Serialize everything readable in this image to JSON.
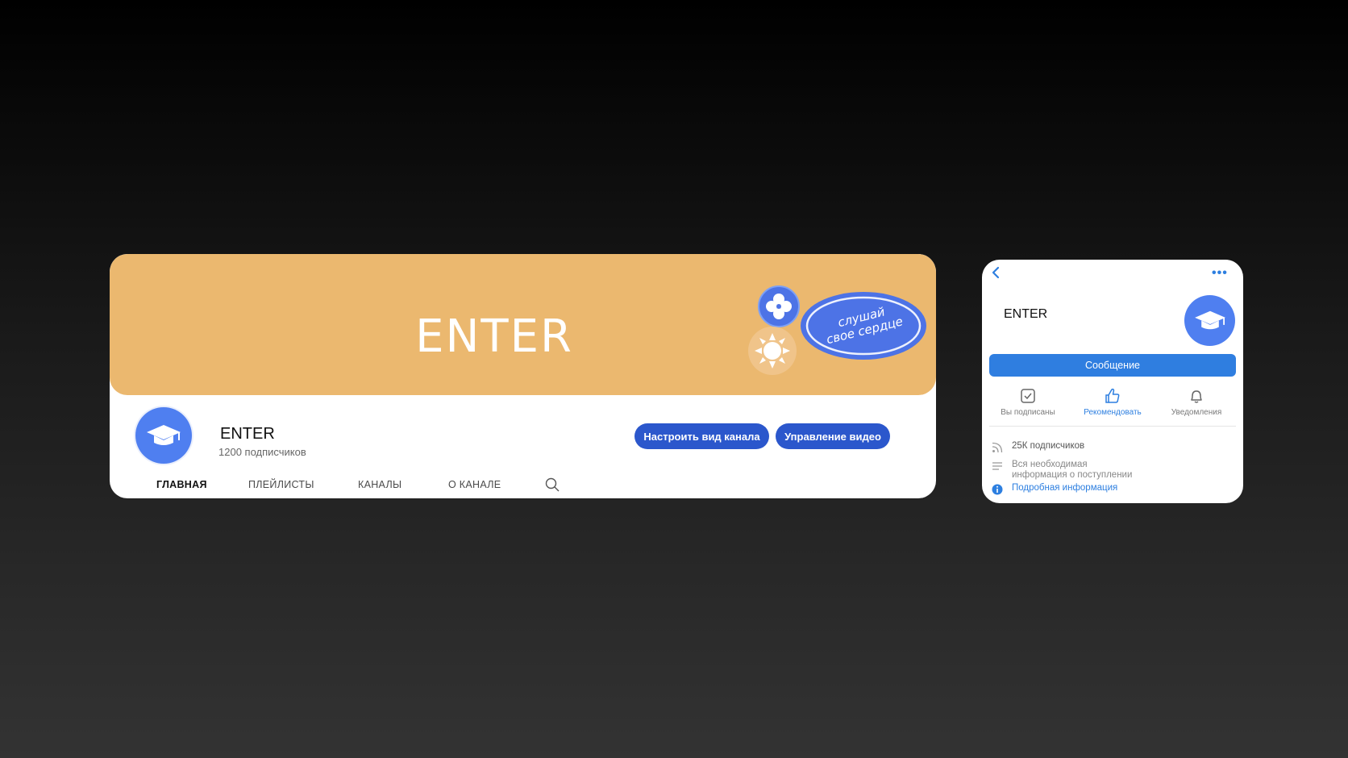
{
  "desktop": {
    "banner": {
      "title": "ENTER",
      "sticker_line1": "слушай",
      "sticker_line2": "свое сердце",
      "background_color": "#ebb86f"
    },
    "channel": {
      "name": "ENTER",
      "subscribers": "1200 подписчиков",
      "avatar_icon": "graduation-cap-icon"
    },
    "buttons": {
      "customize": "Настроить вид канала",
      "manage": "Управление видео",
      "color": "#2b57cc"
    },
    "tabs": [
      {
        "label": "ГЛАВНАЯ",
        "active": true
      },
      {
        "label": "ПЛЕЙЛИСТЫ",
        "active": false
      },
      {
        "label": "КАНАЛЫ",
        "active": false
      },
      {
        "label": "О КАНАЛЕ",
        "active": false
      }
    ],
    "search_icon": "search-icon"
  },
  "mobile": {
    "back_icon": "chevron-left-icon",
    "more_label": "•••",
    "channel_name": "ENTER",
    "avatar_icon": "graduation-cap-icon",
    "message_button": "Сообщение",
    "actions": [
      {
        "label": "Вы подписаны",
        "icon": "checkbox-icon"
      },
      {
        "label": "Рекомендовать",
        "icon": "thumbs-up-icon"
      },
      {
        "label": "Уведомления",
        "icon": "bell-icon"
      }
    ],
    "info": {
      "subscribers": "25К подписчиков",
      "description_line1": "Вся необходимая",
      "description_line2": "информация о поступлении",
      "details_link": "Подробная информация"
    },
    "accent_color": "#2d7fe0"
  }
}
